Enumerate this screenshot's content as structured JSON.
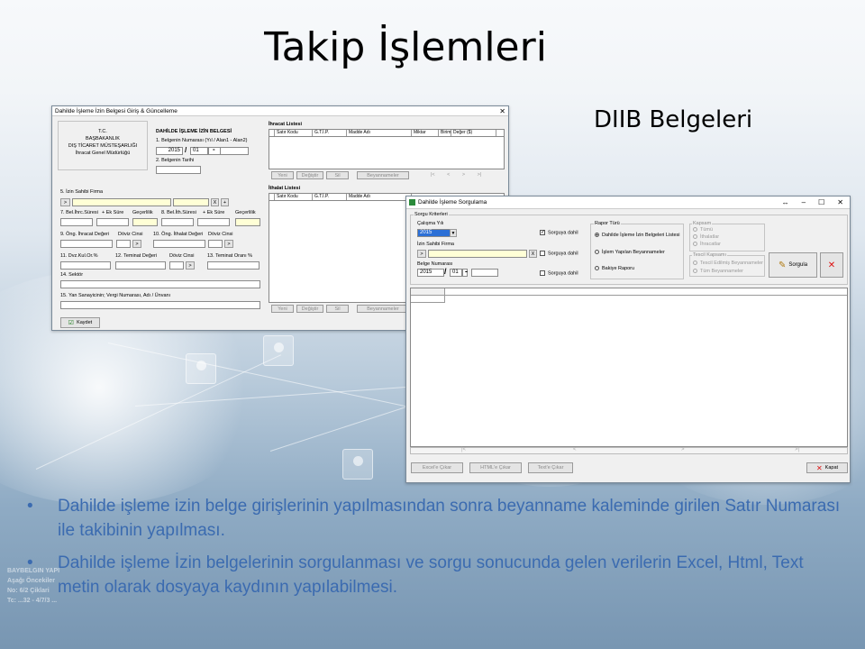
{
  "slide": {
    "title": "Takip İşlemleri",
    "subtitle": "DIIB Belgeleri",
    "bullets": [
      "Dahilde işleme izin belge girişlerinin yapılmasından sonra beyanname kaleminde girilen Satır Numarası ile takibinin yapılması.",
      "Dahilde işleme İzin belgelerinin sorgulanması ve sorgu sonucunda gelen verilerin Excel, Html, Text metin olarak dosyaya kaydının yapılabilmesi."
    ],
    "bg_text": [
      "BAYBELGIN YAPI",
      "Aşağı Öncekiler",
      "No: 6/2 Çiklari",
      "Tc: ...32 - 4/7/3 ..."
    ]
  },
  "win1": {
    "title": "Dahilde İşleme İzin Belgesi Giriş & Güncelleme",
    "close": "✕",
    "org": [
      "T.C.",
      "BAŞBAKANLIK",
      "DIŞ TİCARET MÜSTEŞARLIĞI",
      "İhracat Genel Müdürlüğü"
    ],
    "header": "DAHİLDE İŞLEME İZİN BELGESİ",
    "belge_no_label": "1. Belgenin Numarası (Yıl / Alan1 - Alan2)",
    "belge_year": "2015",
    "belge_a1": "01",
    "slash": "/",
    "dash": "-",
    "tarih_label": "2. Belgenin Tarihi",
    "firma_label": "5. İzin Sahibi Firma",
    "row7": [
      "7. Bel.İhrc.Süresi",
      "+ Ek Süre",
      "Geçerlilik",
      "8. Bel.İth.Süresi",
      "+ Ek Süre",
      "Geçerlilik"
    ],
    "row9": [
      "9. Öng. İhracat Değeri",
      "Döviz Cinsi",
      "10. Öng. İthalat Değeri",
      "Döviz Cinsi"
    ],
    "row11": [
      "11. Dvz.Kul.Or.%",
      "12. Teminat Değeri",
      "Döviz Cinsi",
      "13. Teminat Oranı %"
    ],
    "sektor_label": "14. Sektör",
    "sanayici_label": "15. Yan Sanayicinin; Vergi Numarası, Adı / Ünvanı",
    "save": "Kaydet",
    "ihracat_title": "İhracat Listesi",
    "ihracat_cols": [
      "Satır Kodu",
      "G.T.İ.P.",
      "Madde Adı",
      "Miktar",
      "Birim",
      "Değer ($)"
    ],
    "ithalat_title": "İthalat Listesi",
    "ithalat_cols": [
      "Satır Kodu",
      "G.T.İ.P.",
      "Madde Adı"
    ],
    "list_buttons": [
      "Yeni",
      "Değiştir",
      "Sil",
      "Beyannameler"
    ],
    "nav": [
      "|<",
      "<",
      ">",
      ">|"
    ],
    "x_btn": "X",
    "plus_btn": "+",
    "arrow_btn": ">"
  },
  "win2": {
    "title": "Dahilde İşleme Sorgulama",
    "win_controls": [
      "↔",
      "–",
      "☐",
      "✕"
    ],
    "kriter_title": "Sorgu Kriterleri",
    "yil_label": "Çalışma Yılı",
    "yil_value": "2015",
    "firma_label": "İzin Sahibi Firma",
    "belge_label": "Belge Numarası",
    "belge_year": "2015",
    "belge_a1": "01",
    "sorguya_dahil": "Sorguya dahil",
    "rapor_title": "Rapor Türü",
    "rapor_opts": [
      "Dahilde İşleme İzin Belgeleri Listesi",
      "İşlem Yapılan Beyannameler",
      "Bakiye Raporu"
    ],
    "kapsam_title": "Kapsam",
    "kapsam_opts": [
      "Tümü",
      "İthalatlar",
      "İhracatlar"
    ],
    "tescil_title": "Tescil Kapsamı",
    "tescil_opts": [
      "Tescil Edilmiş Beyannameler",
      "Tüm Beyannameler"
    ],
    "sorgula": "Sorgula",
    "cancel": "✕",
    "export_buttons": [
      "Excel'e Çıkar",
      "HTML'e Çıkar",
      "Text'e Çıkar"
    ],
    "kapat": "Kapat",
    "x_btn": "X",
    "arrow_btn": ">",
    "slash": "/",
    "dash": "-"
  }
}
